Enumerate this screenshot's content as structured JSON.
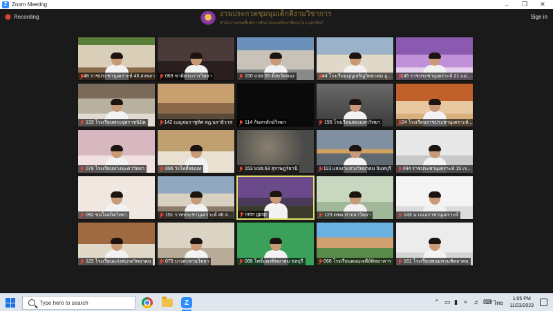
{
  "window": {
    "title": "Zoom Meeting"
  },
  "meeting": {
    "recording_label": "Recording",
    "sign_in_label": "Sign in",
    "banner_line1": "งานประกวดชุมนุมเด็กดีงามวิชาการ",
    "banner_line2": "สำนักงานเขตพื้นที่การศึกษามัธยมศึกษาพิษณุโลก อุตรดิตถ์"
  },
  "participants": [
    {
      "name": "148 ราชประชานุเคราะห์ 45 สงขลา",
      "scene": "stage",
      "person": true
    },
    {
      "name": "063 ชาติตระการวิทยา",
      "scene": "office",
      "person": true
    },
    {
      "name": "150 บปส.55 ตั้งหวัดทอง",
      "scene": "room",
      "person": true
    },
    {
      "name": "144 โรงเรียนบุญเจริญวิทยาคม อุ...",
      "scene": "hall",
      "person": true
    },
    {
      "name": "145 ราชประชานุเคราะห์ 21 แม่...",
      "scene": "purple",
      "person": true
    },
    {
      "name": "133 โรงเรียนพระยุพราชนิมิต",
      "scene": "library",
      "person": true
    },
    {
      "name": "142 เบญจมราชูทิศ สฎ.นราธิวาส",
      "scene": "meeting",
      "person": false
    },
    {
      "name": "114 กันทรลักษ์วิทยา",
      "scene": "dark",
      "person": false
    },
    {
      "name": "155 โรงเรียนสองแคววิทยา",
      "scene": "grey",
      "person": true
    },
    {
      "name": "124 โรงเรียนราชประชานุเคราะห์...",
      "scene": "orange",
      "person": true
    },
    {
      "name": "078 โรงเรียนปางมะค่าวิทยา",
      "scene": "pink",
      "person": true
    },
    {
      "name": "096 วังโพธิ์ชนบท",
      "scene": "shelf",
      "person": true
    },
    {
      "name": "153 บปส.63 สุราษฎร์ธานี",
      "scene": "blur",
      "person": false
    },
    {
      "name": "113 แสงงาแสวงวิทยาคม จันทบุรี",
      "scene": "sky",
      "person": true
    },
    {
      "name": "094 ราชประชานุเคราะห์ 15 เร...",
      "scene": "whiteroom",
      "person": true
    },
    {
      "name": "092 ชนใจสถิตวิทยา",
      "scene": "poster",
      "person": true
    },
    {
      "name": "151 ราชประชานุเคราะห์ 46 ส...",
      "scene": "class",
      "person": true
    },
    {
      "name": "inter gpsp",
      "scene": "stage2",
      "person": true,
      "active": true
    },
    {
      "name": "123 ตชด.ท่าปลาวิทยา",
      "scene": "green",
      "person": true
    },
    {
      "name": "143 นางแลราชานุเคราะห์",
      "scene": "white2",
      "person": true
    },
    {
      "name": "122 โรงเรียนแก่งสะกดวิทยาคม",
      "scene": "shelf2",
      "person": true
    },
    {
      "name": "075 บางสะพานวิทยา",
      "scene": "desk",
      "person": true
    },
    {
      "name": "068 โพธิ์แดงพิทยาคม ชลบุรี",
      "scene": "greenwall",
      "person": true
    },
    {
      "name": "066 โรงเรียนดอนเจดีย์พิทยาคาร",
      "scene": "outdoor",
      "person": false
    },
    {
      "name": "161 โรงเรียนพนมทวนพิทยาคม",
      "scene": "white3",
      "person": true
    }
  ],
  "taskbar": {
    "search_placeholder": "Type here to search",
    "time": "1:05 PM",
    "date": "11/23/2023",
    "language": "ไทย"
  }
}
